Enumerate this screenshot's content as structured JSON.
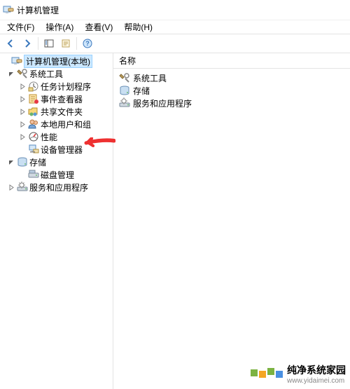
{
  "window": {
    "title": "计算机管理"
  },
  "menu": {
    "file": "文件(F)",
    "action": "操作(A)",
    "view": "查看(V)",
    "help": "帮助(H)"
  },
  "tree": {
    "root": {
      "label": "计算机管理(本地)"
    },
    "system_tools": {
      "label": "系统工具"
    },
    "task_scheduler": {
      "label": "任务计划程序"
    },
    "event_viewer": {
      "label": "事件查看器"
    },
    "shared_folders": {
      "label": "共享文件夹"
    },
    "local_users": {
      "label": "本地用户和组"
    },
    "performance": {
      "label": "性能"
    },
    "device_manager": {
      "label": "设备管理器"
    },
    "storage": {
      "label": "存储"
    },
    "disk_management": {
      "label": "磁盘管理"
    },
    "services_apps": {
      "label": "服务和应用程序"
    }
  },
  "list": {
    "header_name": "名称",
    "items": [
      {
        "label": "系统工具"
      },
      {
        "label": "存储"
      },
      {
        "label": "服务和应用程序"
      }
    ]
  },
  "watermark": {
    "text": "纯净系统家园",
    "url": "www.yidaimei.com"
  },
  "colors": {
    "selection": "#cce8ff",
    "arrow": "#ee3131",
    "logo_green": "#7cb342",
    "logo_orange": "#f5a623",
    "logo_blue": "#4a90e2"
  }
}
